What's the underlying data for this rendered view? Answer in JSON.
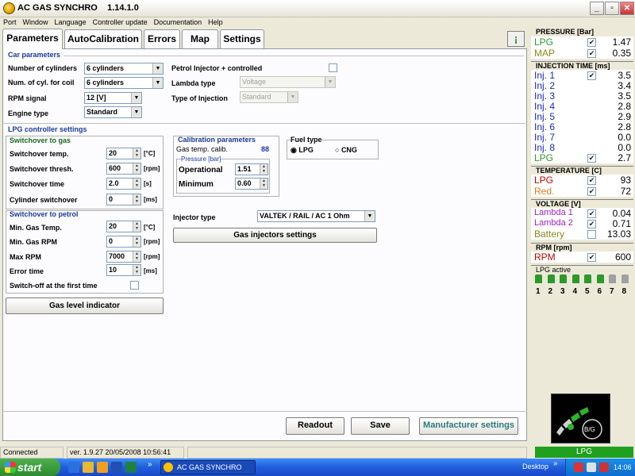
{
  "window": {
    "title": "AC GAS SYNCHRO",
    "version": "1.14.1.0"
  },
  "menu": [
    "Port",
    "Window",
    "Language",
    "Controller update",
    "Documentation",
    "Help"
  ],
  "tabs": [
    "Parameters",
    "AutoCalibration",
    "Errors",
    "Map",
    "Settings"
  ],
  "car": {
    "title": "Car parameters",
    "cylinders_label": "Number of cylinders",
    "cylinders_value": "6 cylinders",
    "coil_label": "Num. of cyl. for coil",
    "coil_value": "6 cylinders",
    "rpm_label": "RPM signal",
    "rpm_value": "12 [V]",
    "engine_label": "Engine type",
    "engine_value": "Standard",
    "petrol_inj_label": "Petrol Injector + controlled",
    "lambda_label": "Lambda type",
    "lambda_value": "Voltage",
    "injection_label": "Type of Injection",
    "injection_value": "Standard"
  },
  "lpg": {
    "title": "LPG controller settings",
    "switch_gas_title": "Switchover to gas",
    "sw_temp_label": "Switchover temp.",
    "sw_temp_value": "20",
    "sw_temp_unit": "[°C]",
    "sw_thresh_label": "Switchover thresh.",
    "sw_thresh_value": "600",
    "sw_thresh_unit": "[rpm]",
    "sw_time_label": "Switchover time",
    "sw_time_value": "2.0",
    "sw_time_unit": "[s]",
    "cyl_sw_label": "Cylinder switchover",
    "cyl_sw_value": "0",
    "cyl_sw_unit": "[ms]",
    "switch_petrol_title": "Switchover to petrol",
    "min_temp_label": "Min. Gas Temp.",
    "min_temp_value": "20",
    "min_temp_unit": "[°C]",
    "min_rpm_label": "Min. Gas RPM",
    "min_rpm_value": "0",
    "min_rpm_unit": "[rpm]",
    "max_rpm_label": "Max RPM",
    "max_rpm_value": "7000",
    "max_rpm_unit": "[rpm]",
    "err_time_label": "Error time",
    "err_time_value": "10",
    "err_time_unit": "[ms]",
    "switch_off_label": "Switch-off at the first time",
    "gas_level_btn": "Gas level indicator"
  },
  "calib": {
    "title": "Calibration parameters",
    "gas_temp_label": "Gas temp. calib.",
    "gas_temp_value": "88",
    "pressure_title": "Pressure [bar]",
    "operational_label": "Operational",
    "operational_value": "1.51",
    "minimum_label": "Minimum",
    "minimum_value": "0.60"
  },
  "fuel": {
    "title": "Fuel type",
    "lpg": "LPG",
    "cng": "CNG"
  },
  "injector": {
    "label": "Injector type",
    "value": "VALTEK / RAIL / AC 1 Ohm",
    "settings_btn": "Gas injectors settings"
  },
  "buttons": {
    "readout": "Readout",
    "save": "Save",
    "manufacturer": "Manufacturer settings"
  },
  "status": {
    "connected": "Connected",
    "version": "ver. 1.9.27  20/05/2008 10:56:41"
  },
  "right": {
    "pressure_title": "PRESSURE [Bar]",
    "pressure": [
      {
        "name": "LPG",
        "value": "1.47",
        "color": "#2a9a2a"
      },
      {
        "name": "MAP",
        "value": "0.35",
        "color": "#8a8a1a"
      }
    ],
    "injection_title": "INJECTION TIME [ms]",
    "injection": [
      {
        "name": "Inj. 1",
        "value": "3.5"
      },
      {
        "name": "Inj. 2",
        "value": "3.4"
      },
      {
        "name": "Inj. 3",
        "value": "3.5"
      },
      {
        "name": "Inj. 4",
        "value": "2.8"
      },
      {
        "name": "Inj. 5",
        "value": "2.9"
      },
      {
        "name": "Inj. 6",
        "value": "2.8"
      },
      {
        "name": "Inj. 7",
        "value": "0.0"
      },
      {
        "name": "Inj. 8",
        "value": "0.0"
      },
      {
        "name": "LPG",
        "value": "2.7"
      }
    ],
    "temperature_title": "TEMPERATURE [C]",
    "temperature": [
      {
        "name": "LPG",
        "value": "93",
        "color": "#c00000"
      },
      {
        "name": "Red.",
        "value": "72",
        "color": "#e07a20"
      }
    ],
    "voltage_title": "VOLTAGE [V]",
    "voltage": [
      {
        "name": "Lambda 1",
        "value": "0.04",
        "color": "#a020c0"
      },
      {
        "name": "Lambda 2",
        "value": "0.71",
        "color": "#a020c0"
      },
      {
        "name": "Battery",
        "value": "13.03",
        "color": "#8a8a1a"
      }
    ],
    "rpm_title": "RPM [rpm]",
    "rpm": {
      "name": "RPM",
      "value": "600",
      "color": "#c00000"
    },
    "lpg_active_title": "LPG active",
    "lpg_active": [
      "1",
      "2",
      "3",
      "4",
      "5",
      "6",
      "7",
      "8"
    ],
    "gauge_label": "B/G",
    "lpg_status": "LPG"
  },
  "taskbar": {
    "start": "start",
    "task": "AC GAS SYNCHRO",
    "desktop": "Desktop",
    "clock": "14:06"
  }
}
